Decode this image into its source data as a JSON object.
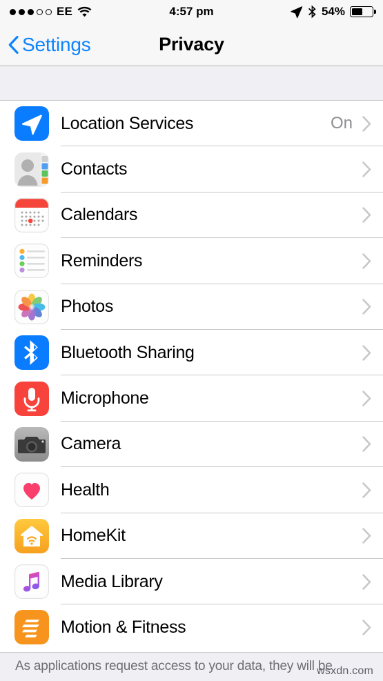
{
  "status_bar": {
    "signal_dots_filled": 3,
    "signal_dots_empty": 2,
    "carrier": "EE",
    "wifi_icon": "wifi-icon",
    "time": "4:57 pm",
    "location_icon": "location-arrow-icon",
    "bluetooth_icon": "bluetooth-icon",
    "battery_percent": "54%",
    "battery_level": 54
  },
  "nav": {
    "back_label": "Settings",
    "back_icon": "chevron-left-icon",
    "title": "Privacy"
  },
  "rows": [
    {
      "label": "Location Services",
      "icon": "location-services-icon",
      "value": "On",
      "chevron": "chevron-right-icon"
    },
    {
      "label": "Contacts",
      "icon": "contacts-icon",
      "value": "",
      "chevron": "chevron-right-icon"
    },
    {
      "label": "Calendars",
      "icon": "calendars-icon",
      "value": "",
      "chevron": "chevron-right-icon"
    },
    {
      "label": "Reminders",
      "icon": "reminders-icon",
      "value": "",
      "chevron": "chevron-right-icon"
    },
    {
      "label": "Photos",
      "icon": "photos-icon",
      "value": "",
      "chevron": "chevron-right-icon"
    },
    {
      "label": "Bluetooth Sharing",
      "icon": "bluetooth-sharing-icon",
      "value": "",
      "chevron": "chevron-right-icon"
    },
    {
      "label": "Microphone",
      "icon": "microphone-icon",
      "value": "",
      "chevron": "chevron-right-icon"
    },
    {
      "label": "Camera",
      "icon": "camera-icon",
      "value": "",
      "chevron": "chevron-right-icon"
    },
    {
      "label": "Health",
      "icon": "health-icon",
      "value": "",
      "chevron": "chevron-right-icon"
    },
    {
      "label": "HomeKit",
      "icon": "homekit-icon",
      "value": "",
      "chevron": "chevron-right-icon"
    },
    {
      "label": "Media Library",
      "icon": "media-library-icon",
      "value": "",
      "chevron": "chevron-right-icon"
    },
    {
      "label": "Motion & Fitness",
      "icon": "motion-fitness-icon",
      "value": "",
      "chevron": "chevron-right-icon"
    }
  ],
  "footer": {
    "text": "As applications request access to your data, they will be",
    "watermark": "wsxdn.com"
  },
  "colors": {
    "accent_blue": "#0b84fe",
    "group_background": "#efeff4",
    "separator": "#c8c7cc",
    "value_gray": "#8e8e93",
    "footer_gray": "#6d6d72"
  }
}
